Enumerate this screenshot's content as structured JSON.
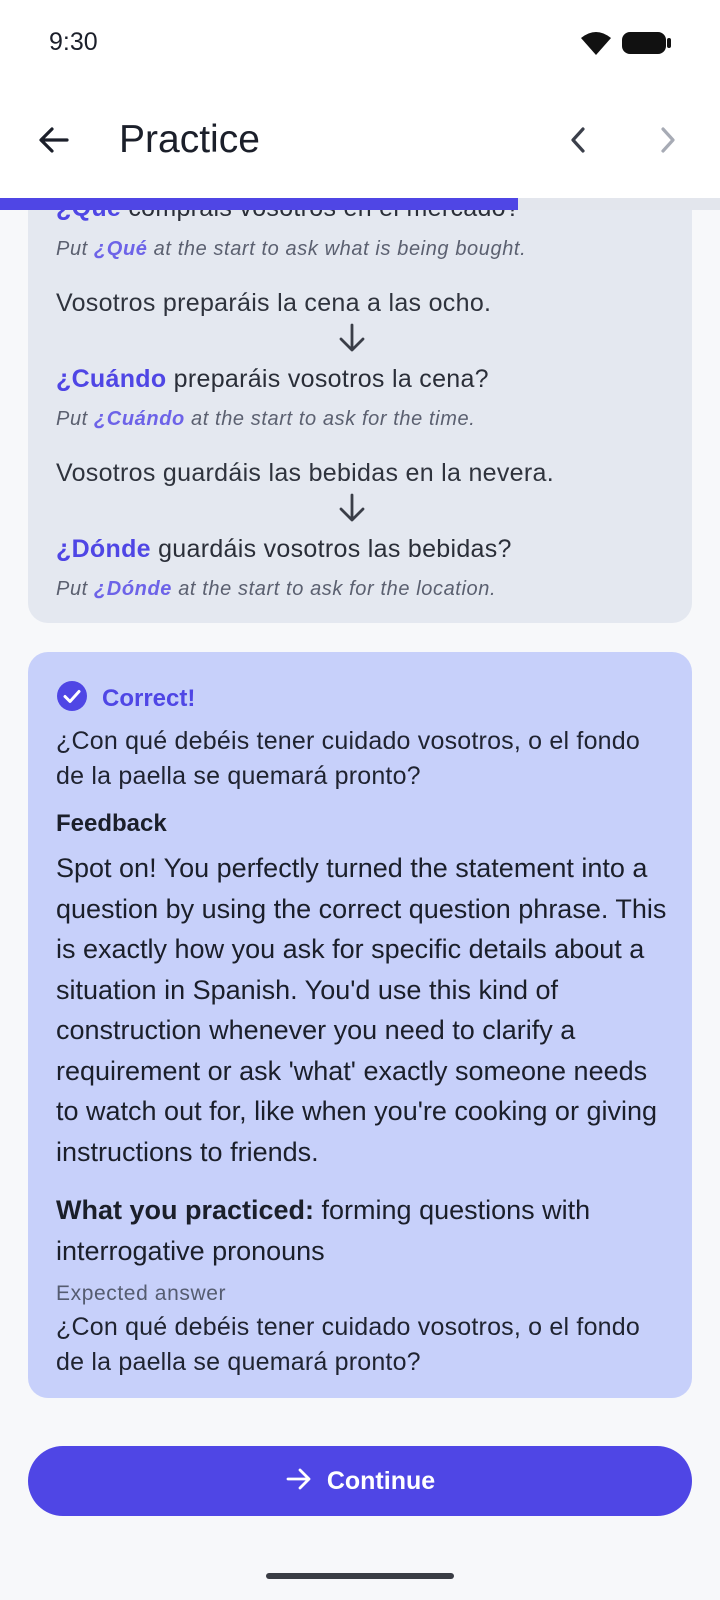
{
  "status_bar": {
    "time": "9:30",
    "icons": [
      "wifi-icon",
      "battery-icon"
    ]
  },
  "app_bar": {
    "title": "Practice",
    "back_icon": "arrow-left-icon",
    "prev_icon": "chevron-left-icon",
    "next_icon": "chevron-right-icon",
    "progress": 0.72
  },
  "examples": {
    "q1": {
      "word": "¿Qué",
      "rest": " comprais vosotros en el mercado?"
    },
    "note1": {
      "prefix": "Put ",
      "word": "¿Qué",
      "suffix": " at the start to ask what is being bought."
    },
    "stmt2": "Vosotros preparáis la cena a las ocho.",
    "q2": {
      "word": "¿Cuándo",
      "rest": " preparáis vosotros la cena?"
    },
    "note2": {
      "prefix": "Put ",
      "word": "¿Cuándo",
      "suffix": " at the start to ask for the time."
    },
    "stmt3": "Vosotros guardáis las bebidas en la nevera.",
    "q3": {
      "word": "¿Dónde",
      "rest": " guardáis vosotros las bebidas?"
    },
    "note3": {
      "prefix": "Put ",
      "word": "¿Dónde",
      "suffix": " at the start to ask for the location."
    }
  },
  "feedback": {
    "status": "Correct!",
    "question": "¿Con qué debéis tener cuidado vosotros, o el fondo de la paella se quemará pronto?",
    "heading": "Feedback",
    "body": "Spot on! You perfectly turned the statement into a question by using the correct question phrase. This is exactly how you ask for specific details about a situation in Spanish. You'd use this kind of construction whenever you need to clarify a requirement or ask 'what' exactly someone needs to watch out for, like when you're cooking or giving instructions to friends.",
    "practiced_label": "What you practiced:",
    "practiced_value": " forming questions with interrogative pronouns",
    "expected_label": "Expected answer",
    "expected_answer": "¿Con qué debéis tener cuidado vosotros, o el fondo de la paella se quemará pronto?"
  },
  "continue_button": {
    "label": "Continue",
    "icon": "arrow-right-icon"
  },
  "colors": {
    "accent": "#4f46e5",
    "feedback_bg": "#c7d0fa",
    "examples_bg": "#e4e8f0"
  }
}
